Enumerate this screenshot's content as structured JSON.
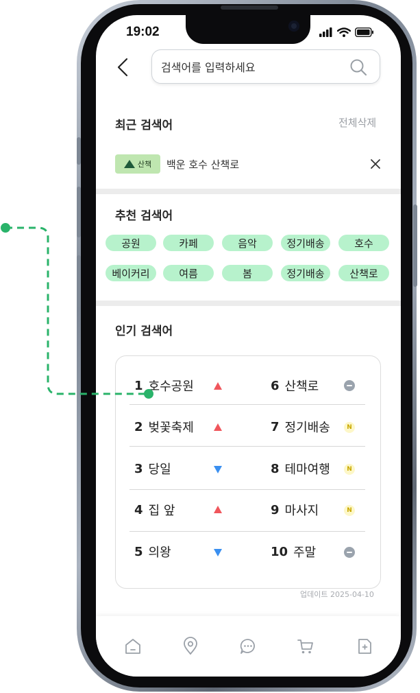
{
  "status_bar": {
    "time": "19:02"
  },
  "search": {
    "placeholder": "검색어를 입력하세요"
  },
  "recent": {
    "title": "최근 검색어",
    "clear_all": "전체삭제",
    "items": [
      {
        "tag": "산책",
        "text": "백운 호수 산책로"
      }
    ]
  },
  "recommended": {
    "title": "추천 검색어",
    "chips": [
      "공원",
      "카페",
      "음악",
      "정기배송",
      "호수",
      "베이커리",
      "여름",
      "봄",
      "정기배송",
      "산책로"
    ]
  },
  "popular": {
    "title": "인기 검색어",
    "items": [
      {
        "rank": "1",
        "name": "호수공원",
        "trend": "up"
      },
      {
        "rank": "2",
        "name": "벚꽃축제",
        "trend": "up"
      },
      {
        "rank": "3",
        "name": "당일",
        "trend": "down"
      },
      {
        "rank": "4",
        "name": "집 앞",
        "trend": "up"
      },
      {
        "rank": "5",
        "name": "의왕",
        "trend": "down"
      },
      {
        "rank": "6",
        "name": "산책로",
        "trend": "same"
      },
      {
        "rank": "7",
        "name": "정기배송",
        "trend": "new",
        "badge": "N"
      },
      {
        "rank": "8",
        "name": "테마여행",
        "trend": "new",
        "badge": "N"
      },
      {
        "rank": "9",
        "name": "마사지",
        "trend": "new",
        "badge": "N"
      },
      {
        "rank": "10",
        "name": "주말",
        "trend": "same"
      }
    ],
    "updated": "업데이트 2025-04-10"
  },
  "bottom_nav": {
    "icons": [
      "home-icon",
      "location-icon",
      "chat-icon",
      "cart-icon",
      "document-icon"
    ]
  },
  "colors": {
    "chip_bg": "#b7f2cc",
    "tag_bg": "#bfe6b0",
    "trend_up": "#f0565c",
    "trend_down": "#3a8ff0",
    "badge_new_bg": "#fdf7c8",
    "annotation": "#2ab36a"
  }
}
